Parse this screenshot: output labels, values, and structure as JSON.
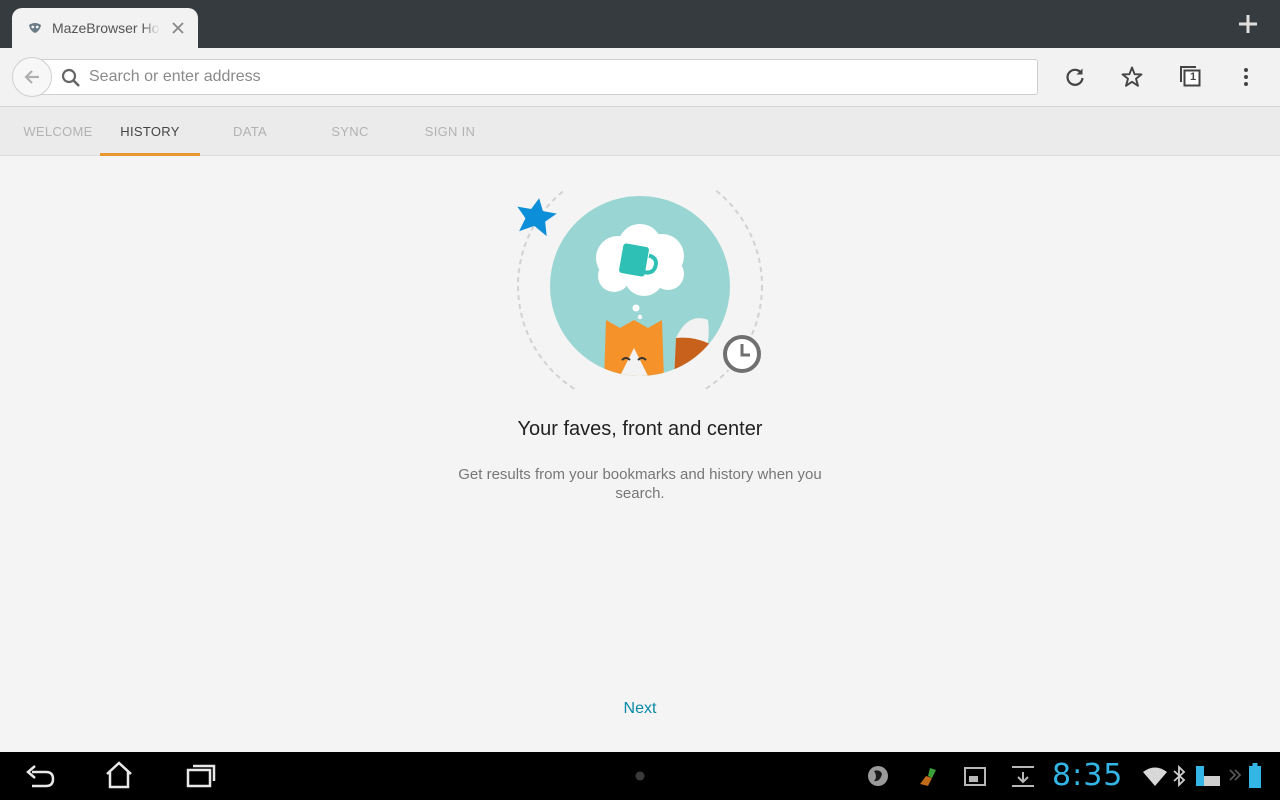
{
  "browser": {
    "tab": {
      "title": "MazeBrowser Home",
      "favicon": "mask-icon"
    },
    "urlbar": {
      "placeholder": "Search or enter address"
    },
    "toolbar": {
      "tab_count": "1"
    }
  },
  "onboarding": {
    "tabs": [
      {
        "label": "WELCOME",
        "active": false
      },
      {
        "label": "HISTORY",
        "active": true
      },
      {
        "label": "DATA",
        "active": false
      },
      {
        "label": "SYNC",
        "active": false
      },
      {
        "label": "SIGN IN",
        "active": false
      }
    ],
    "headline": "Your faves, front and center",
    "subtext": "Get results from your bookmarks and history when you search.",
    "next_label": "Next"
  },
  "system_bar": {
    "time": "8:35"
  },
  "colors": {
    "accent": "#e8962e",
    "link": "#0a89a8",
    "clock": "#33b5e5",
    "tab_strip": "#363b40"
  }
}
